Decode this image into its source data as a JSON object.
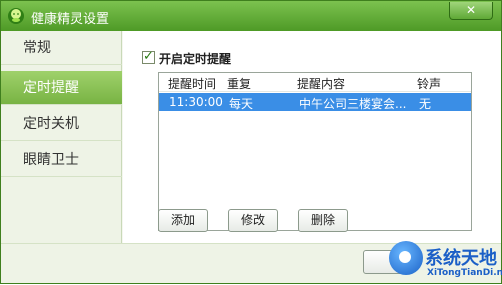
{
  "window": {
    "title": "健康精灵设置",
    "close_label": "✕"
  },
  "sidebar": {
    "items": [
      {
        "label": "常规"
      },
      {
        "label": "定时提醒",
        "active": true
      },
      {
        "label": "定时关机"
      },
      {
        "label": "眼睛卫士"
      }
    ]
  },
  "content": {
    "enable_checkbox": {
      "label": "开启定时提醒",
      "checked": true
    },
    "list": {
      "headers": [
        "提醒时间",
        "重复",
        "提醒内容",
        "铃声"
      ],
      "rows": [
        [
          "11:30:00",
          "每天",
          "中午公司三楼宴会...",
          "无"
        ]
      ]
    },
    "buttons": {
      "add": "添加",
      "edit": "修改",
      "delete": "删除"
    }
  },
  "watermark": {
    "title": "系统天地",
    "subtitle": "XiTongTianDi.net"
  },
  "colors": {
    "accent": "#5ea52f",
    "selection": "#3a8ee6"
  }
}
